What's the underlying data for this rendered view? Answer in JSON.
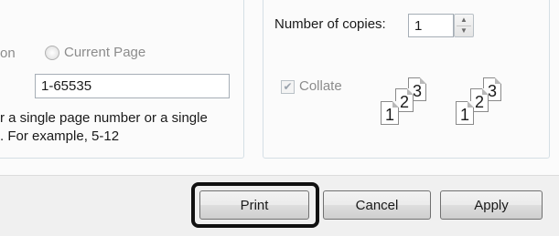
{
  "page_range": {
    "option_partial": "on",
    "current_page_label": "Current Page",
    "pages_value": "1-65535",
    "hint_line1": "r a single page number or a single",
    "hint_line2": ".  For example, 5-12"
  },
  "copies": {
    "label": "Number of copies:",
    "value": "1",
    "collate_label": "Collate",
    "collate_checked": true,
    "stack1_pages": [
      "1",
      "2",
      "3"
    ],
    "stack2_pages": [
      "1",
      "2",
      "3"
    ]
  },
  "buttons": {
    "print": "Print",
    "cancel": "Cancel",
    "apply": "Apply"
  },
  "colors": {
    "highlight_border": "#111111",
    "group_border": "#d5dfe5"
  }
}
